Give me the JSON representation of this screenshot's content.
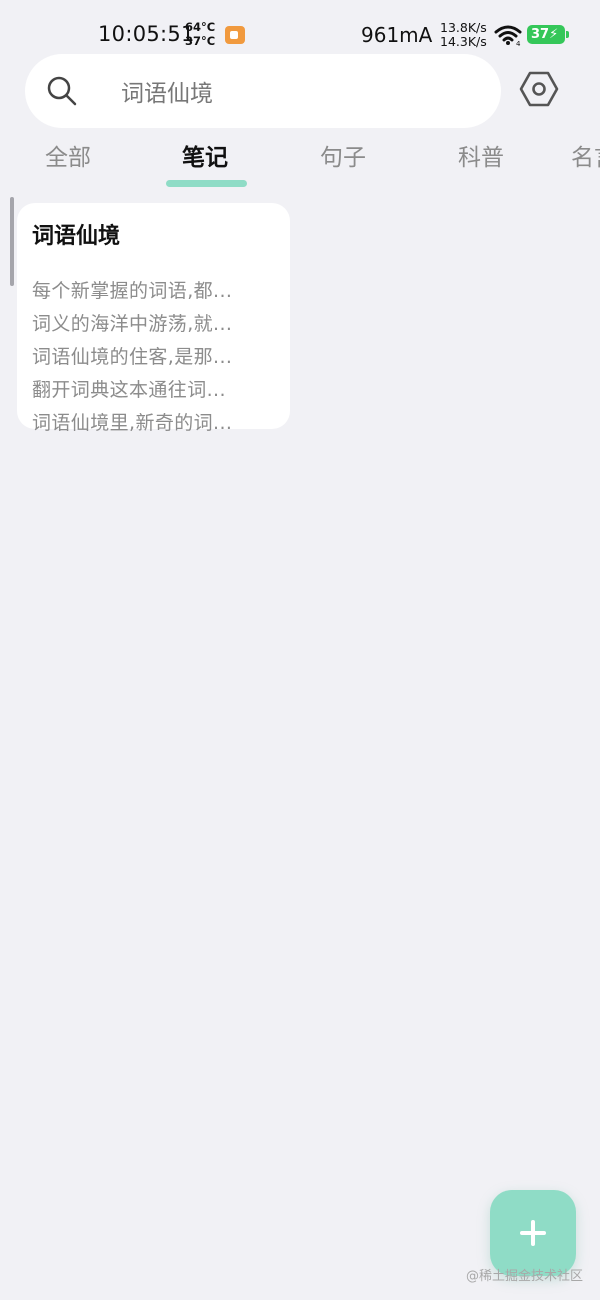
{
  "status_bar": {
    "time": "10:05:51",
    "temp_top": "64°C",
    "temp_bottom": "37°C",
    "current": "961mA",
    "speed_up": "13.8K/s",
    "speed_down": "14.3K/s",
    "battery": "37",
    "icons": [
      "screen-record-icon",
      "wifi-icon",
      "battery-icon"
    ]
  },
  "search": {
    "query": "词语仙境",
    "icon": "search-icon"
  },
  "settings": {
    "icon": "hexagon-settings-icon"
  },
  "tabs": [
    {
      "label": "全部"
    },
    {
      "label": "笔记"
    },
    {
      "label": "句子"
    },
    {
      "label": "科普"
    },
    {
      "label": "名言"
    }
  ],
  "active_tab": "笔记",
  "notes": [
    {
      "title": "词语仙境",
      "lines": [
        "每个新掌握的词语,都...",
        "词义的海洋中游荡,就...",
        "词语仙境的住客,是那...",
        "翻开词典这本通往词...",
        "词语仙境里,新奇的词..."
      ]
    }
  ],
  "fab": {
    "icon": "plus-icon"
  },
  "watermark": "@稀土掘金技术社区",
  "colors": {
    "background": "#f1f1f5",
    "accent": "#8fdcc6",
    "card": "#ffffff",
    "battery": "#35c759",
    "record": "#f19a3e"
  }
}
